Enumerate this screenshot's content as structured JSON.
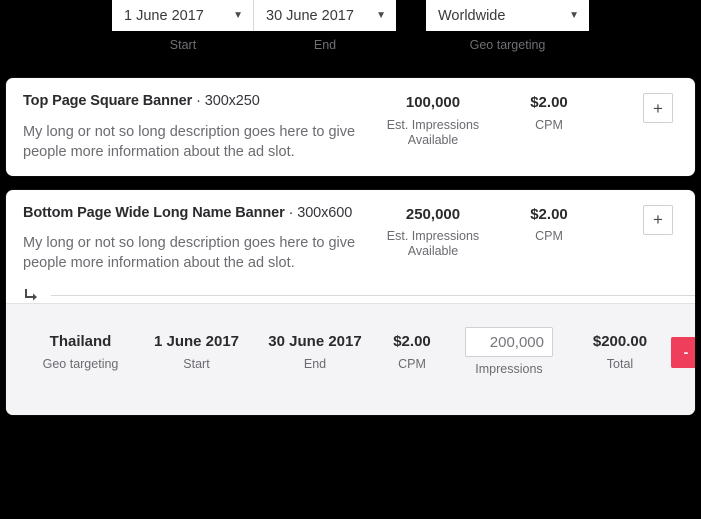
{
  "filters": {
    "start": {
      "value": "1 June 2017",
      "label": "Start",
      "caret": "chevron-down-icon"
    },
    "end": {
      "value": "30 June 2017",
      "label": "End",
      "caret": "chevron-down-icon"
    },
    "geo": {
      "value": "Worldwide",
      "label": "Geo targeting",
      "caret": "chevron-down-icon"
    }
  },
  "colors": {
    "page_background": "#000000",
    "card_background": "#ffffff",
    "expanded_background": "#f4f4f6",
    "remove_button": "#ef3e5c",
    "text_primary": "#2b2b2e",
    "text_muted": "#6b6b71"
  },
  "slots": [
    {
      "name": "Top Page Square Banner",
      "separator": "·",
      "dimensions": "300x250",
      "description": "My long or not so long description goes here to give people more information about the ad slot.",
      "impressions_value": "100,000",
      "impressions_label": "Est. Impressions Available",
      "cpm_value": "$2.00",
      "cpm_label": "CPM",
      "add_button": "+"
    },
    {
      "name": "Bottom Page Wide Long Name Banner",
      "separator": "·",
      "dimensions": "300x600",
      "description": "My long or not so long description goes here to give people more information about the ad slot.",
      "impressions_value": "250,000",
      "impressions_label": "Est. Impressions Available",
      "cpm_value": "$2.00",
      "cpm_label": "CPM",
      "add_button": "+"
    }
  ],
  "booking": {
    "corner_arrow": "arrow-turn-down-right-icon",
    "geo_value": "Thailand",
    "geo_label": "Geo targeting",
    "start_value": "1 June 2017",
    "start_label": "Start",
    "end_value": "30 June 2017",
    "end_label": "End",
    "cpm_value": "$2.00",
    "cpm_label": "CPM",
    "impressions_value": "200,000",
    "impressions_placeholder": "200,000",
    "impressions_label": "Impressions",
    "total_value": "$200.00",
    "total_label": "Total",
    "remove_button": "-"
  }
}
